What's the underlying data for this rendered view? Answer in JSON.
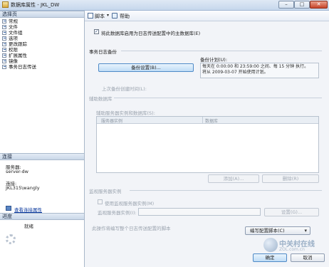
{
  "window": {
    "title": "数据库属性 - JKL_DW",
    "min_label": "–",
    "max_label": "□",
    "close_label": "✕"
  },
  "left": {
    "select_page_header": "选择页",
    "pages": [
      "常规",
      "文件",
      "文件组",
      "选项",
      "更改跟踪",
      "权限",
      "扩展属性",
      "镜像",
      "事务日志传送"
    ],
    "connection_header": "连接",
    "server_label": "服务器:",
    "server_value": "server-dw",
    "conn_label": "连接:",
    "conn_value": "JKL315\\wangly",
    "view_conn_link": "查看连接属性",
    "progress_header": "进度",
    "progress_status": "就绪"
  },
  "toolbar": {
    "script_label": "脚本",
    "help_label": "帮助"
  },
  "main": {
    "enable_primary_label": "将此数据库启用为日志传送配置中的主数据库(E)",
    "enable_primary_checked": true,
    "tlog_backup_section": "事务日志备份",
    "backup_settings_button": "备份设置(B)...",
    "backup_schedule_label": "备份计划(U):",
    "backup_schedule_line1": "每天在 0:00:00 和 23:59:00 之间、每 15 分钟 执行。",
    "backup_schedule_line2": "将从 2009-03-07 开始使用计划。",
    "last_backup_label": "上次备份创建时间(L):",
    "secondary_section": "辅助数据库",
    "secondary_instances_label": "辅助服务器实例和数据库(S):",
    "grid_col1": "服务器实例",
    "grid_col2": "数据库",
    "add_button": "添加(A)...",
    "remove_button": "删除(R)",
    "monitor_section": "监视服务器实例",
    "use_monitor_label": "使用监视服务器实例(M)",
    "monitor_instance_label": "监视服务器实例(I):",
    "monitor_settings_button": "设置(G)...",
    "script_config_label": "此操作将编写整个日志传送配置的脚本",
    "script_config_dropdown": "编写配置脚本(C)",
    "ok_button": "确定",
    "cancel_button": "取消"
  },
  "watermark": {
    "text": "中关村在线",
    "sub": "ZOL.com.cn"
  }
}
